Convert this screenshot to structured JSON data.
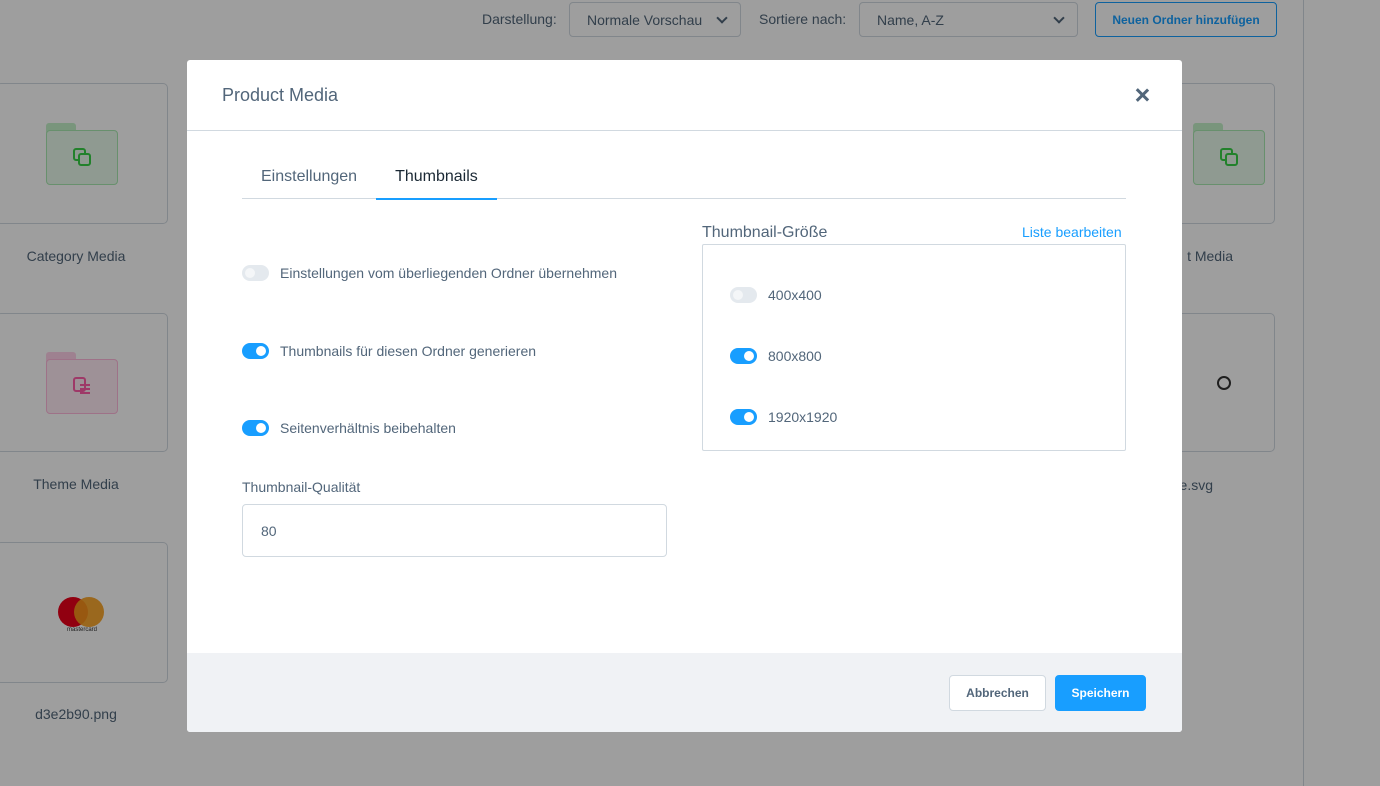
{
  "toolbar": {
    "display_label": "Darstellung:",
    "display_value": "Normale Vorschau",
    "sort_label": "Sortiere nach:",
    "sort_value": "Name, A-Z",
    "new_folder_button": "Neuen Ordner hinzufügen"
  },
  "background_items": [
    {
      "label": "Category Media",
      "icon": "folder-icon"
    },
    {
      "label": "Theme Media",
      "icon": "folder-icon"
    },
    {
      "label": "d3e2b90.png",
      "icon": "mastercard-logo"
    },
    {
      "label": "t Media",
      "icon": "folder-icon"
    },
    {
      "label": "e.svg",
      "icon": "image-icon"
    }
  ],
  "mastercard_text": "mastercard",
  "modal": {
    "title": "Product Media",
    "tabs": [
      {
        "label": "Einstellungen",
        "active": false
      },
      {
        "label": "Thumbnails",
        "active": true
      }
    ],
    "settings": [
      {
        "label": "Einstellungen vom überliegenden Ordner übernehmen",
        "on": false
      },
      {
        "label": "Thumbnails für diesen Ordner generieren",
        "on": true
      },
      {
        "label": "Seitenverhältnis beibehalten",
        "on": true
      }
    ],
    "quality_label": "Thumbnail-Qualität",
    "quality_value": "80",
    "size_title": "Thumbnail-Größe",
    "edit_list_link": "Liste bearbeiten",
    "sizes": [
      {
        "label": "400x400",
        "on": false
      },
      {
        "label": "800x800",
        "on": true
      },
      {
        "label": "1920x1920",
        "on": true
      }
    ],
    "cancel_button": "Abbrechen",
    "save_button": "Speichern"
  },
  "colors": {
    "accent": "#189eff",
    "text": "#52667a",
    "folder_green": "#37d046",
    "folder_pink": "#ff85c2",
    "mastercard_red": "#eb001b",
    "mastercard_orange": "#f79e1b"
  }
}
